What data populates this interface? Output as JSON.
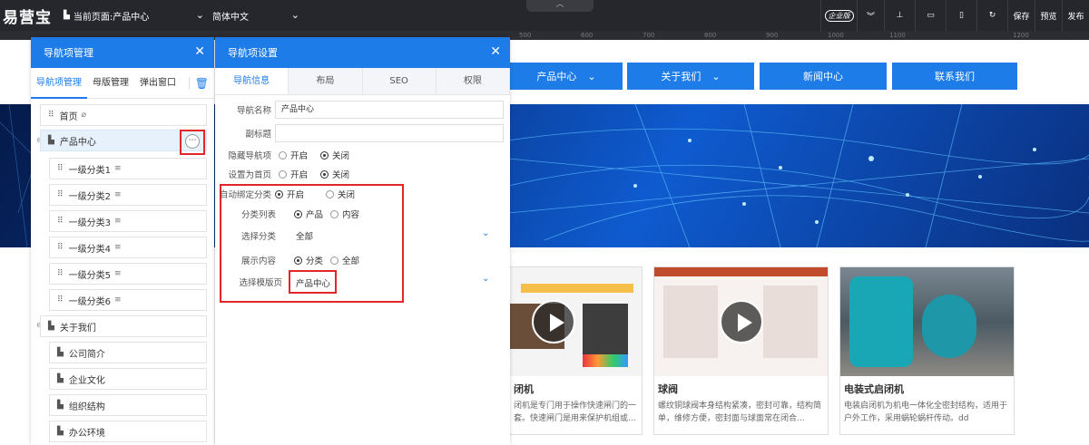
{
  "topbar": {
    "logo": "易营宝",
    "current_page": "当前页面:产品中心",
    "language": "简体中文",
    "tools": [
      "企业版",
      "",
      "",
      "",
      "",
      "",
      "保存",
      "预览",
      "发布"
    ]
  },
  "ruler_ticks": [
    "500",
    "600",
    "700",
    "800",
    "900",
    "1000",
    "1100",
    "1200"
  ],
  "site": {
    "nav_items": [
      "产品中心",
      "关于我们",
      "新闻中心",
      "联系我们"
    ],
    "products": [
      {
        "title": "闭机",
        "desc": "闭机是专门用于操作快速闸门的一套。快速闸门是用来保护机组或..."
      },
      {
        "title": "球阀",
        "desc": "螺纹铜球阀本身结构紧凑，密封可靠，结构简单，维修方便，密封面与球面常在闭合..."
      },
      {
        "title": "电装式启闭机",
        "desc": "电装启闭机为机电一体化全密封结构，适用于户外工作，采用蜗轮蜗杆传动。dd"
      }
    ]
  },
  "left_panel": {
    "title": "导航项管理",
    "tabs": [
      "导航项管理",
      "母版管理",
      "弹出窗口"
    ],
    "tree": {
      "home": "首页",
      "product_center": "产品中心",
      "subs": [
        "一级分类1",
        "一级分类2",
        "一级分类3",
        "一级分类4",
        "一级分类5",
        "一级分类6"
      ],
      "about": "关于我们",
      "about_subs": [
        "公司简介",
        "企业文化",
        "组织结构",
        "办公环境"
      ]
    }
  },
  "right_panel": {
    "title": "导航项设置",
    "tabs": [
      "导航信息",
      "布局",
      "SEO",
      "权限"
    ],
    "nav_name_label": "导航名称",
    "nav_name_value": "产品中心",
    "subtitle_label": "副标题",
    "subtitle_value": "",
    "hide_label": "隐藏导航项",
    "set_home_label": "设置为首页",
    "on": "开启",
    "off": "关闭",
    "auto_bind_label": "自动绑定分类",
    "cat_list_label": "分类列表",
    "cat_list_opt1": "产品",
    "cat_list_opt2": "内容",
    "choose_cat_label": "选择分类",
    "choose_cat_value": "全部",
    "show_content_label": "展示内容",
    "show_opt1": "分类",
    "show_opt2": "全部",
    "template_label": "选择模版页",
    "template_value": "产品中心"
  },
  "colors": {
    "accent": "#1e7ce8",
    "highlight": "#e3262a",
    "topbar": "#25272d"
  }
}
